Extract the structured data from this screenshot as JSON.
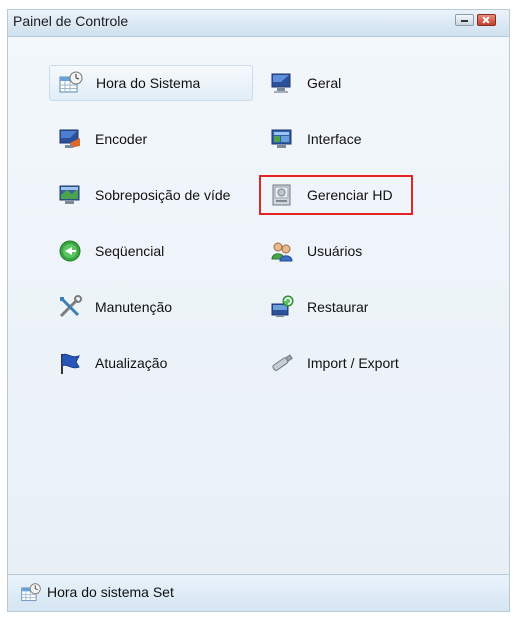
{
  "window": {
    "title": "Painel de Controle"
  },
  "menu": {
    "left": [
      {
        "label": "Hora do Sistema",
        "icon": "calendar-clock-icon"
      },
      {
        "label": "Encoder",
        "icon": "encoder-monitor-icon"
      },
      {
        "label": "Sobreposição de víde",
        "icon": "video-overlay-monitor-icon"
      },
      {
        "label": "Seqüencial",
        "icon": "sequence-green-arrow-icon"
      },
      {
        "label": "Manutenção",
        "icon": "tools-icon"
      },
      {
        "label": "Atualização",
        "icon": "flag-icon"
      }
    ],
    "right": [
      {
        "label": "Geral",
        "icon": "general-monitor-icon"
      },
      {
        "label": "Interface",
        "icon": "interface-monitor-icon"
      },
      {
        "label": "Gerenciar HD",
        "icon": "hard-drive-icon"
      },
      {
        "label": "Usuários",
        "icon": "users-icon"
      },
      {
        "label": "Restaurar",
        "icon": "restore-icon"
      },
      {
        "label": "Import / Export",
        "icon": "usb-pen-icon"
      }
    ]
  },
  "status": {
    "text": "Hora do sistema Set",
    "icon": "calendar-clock-icon"
  },
  "colors": {
    "highlight_border": "#e52524",
    "accent": "#2f6fbf"
  }
}
